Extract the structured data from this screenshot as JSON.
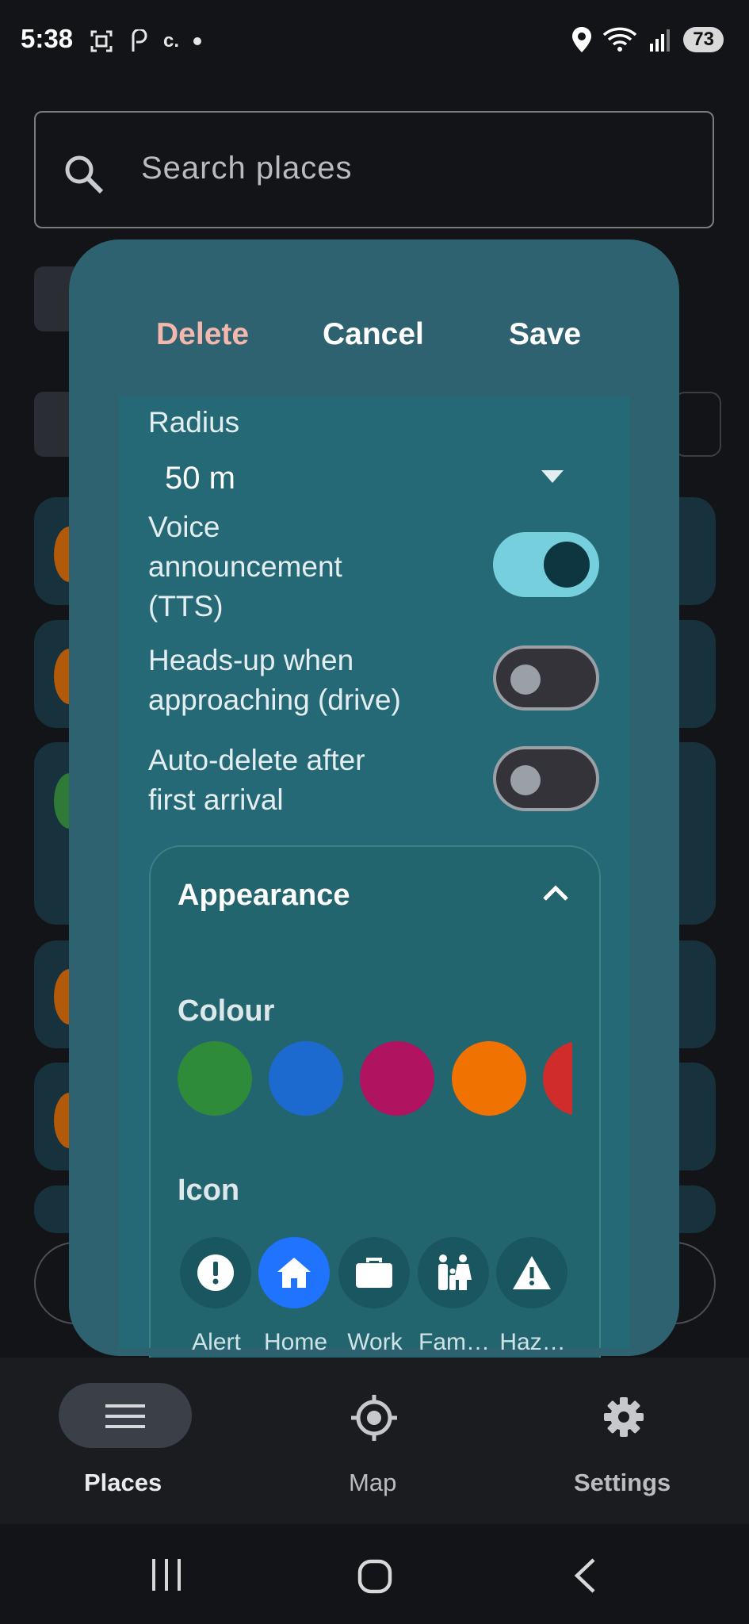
{
  "status_bar": {
    "time": "5:38",
    "battery": "73",
    "left_icons": [
      "screenshot-icon",
      "notification-icon",
      "c-icon",
      "dot-icon"
    ]
  },
  "search": {
    "placeholder": "Search places"
  },
  "dialog": {
    "actions": {
      "delete": "Delete",
      "cancel": "Cancel",
      "save": "Save"
    },
    "radius": {
      "label": "Radius",
      "value": "50 m"
    },
    "toggles": [
      {
        "label_lines": [
          "Voice",
          "announcement",
          "(TTS)"
        ],
        "on": true
      },
      {
        "label_lines": [
          "Heads-up when",
          "approaching (drive)"
        ],
        "on": false
      },
      {
        "label_lines": [
          "Auto-delete after",
          "first arrival"
        ],
        "on": false
      }
    ],
    "appearance": {
      "title": "Appearance",
      "colour_label": "Colour",
      "colours": [
        "#2e8b3a",
        "#1c6ad0",
        "#b0135f",
        "#f07200",
        "#d12c2c"
      ],
      "icon_label": "Icon",
      "icons": [
        {
          "name": "alert-icon",
          "label": "Alert"
        },
        {
          "name": "home-icon",
          "label": "Home",
          "selected": true
        },
        {
          "name": "work-icon",
          "label": "Work"
        },
        {
          "name": "family-icon",
          "label": "Fam…"
        },
        {
          "name": "hazard-icon",
          "label": "Haz…"
        }
      ]
    }
  },
  "nav": {
    "places": "Places",
    "map": "Map",
    "settings": "Settings",
    "active": "Places"
  }
}
